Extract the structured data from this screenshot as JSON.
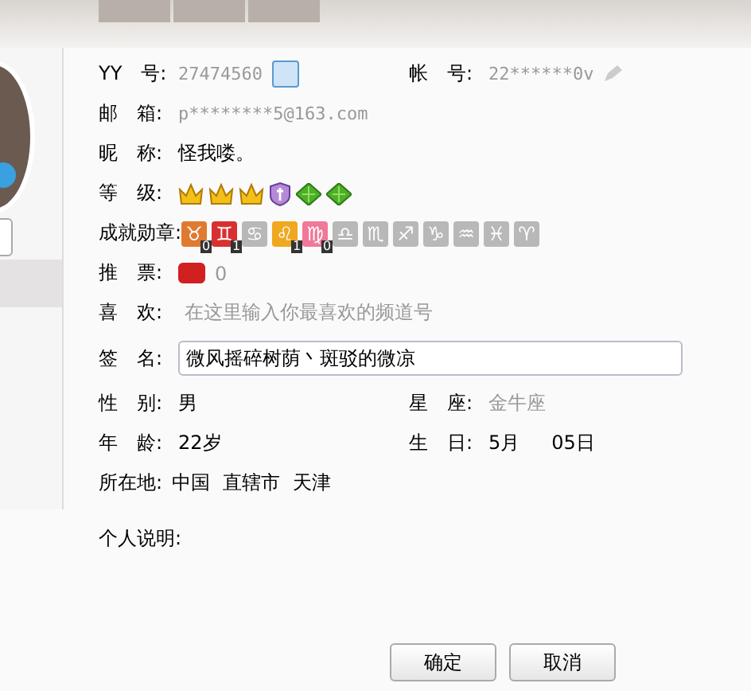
{
  "profile": {
    "fields": [
      {
        "kind": "id",
        "label": "YY　号:",
        "value": "27474560",
        "label2": "帐　号:",
        "value2": "22******0v"
      },
      {
        "kind": "muted",
        "label": "邮　箱:",
        "value": "p********5@163.com"
      },
      {
        "kind": "plain",
        "label": "昵　称:",
        "value": "怪我喽。"
      }
    ],
    "level": {
      "label": "等　级:",
      "icons": [
        {
          "kind": "crown"
        },
        {
          "kind": "crown"
        },
        {
          "kind": "crown"
        },
        {
          "kind": "shield"
        },
        {
          "kind": "leaf"
        },
        {
          "kind": "leaf"
        }
      ]
    },
    "medals": {
      "label": "成就勋章:",
      "items": [
        {
          "symbol": "♉",
          "color": "#e07a30",
          "count": "0"
        },
        {
          "symbol": "♊",
          "color": "#d83030",
          "count": "1"
        },
        {
          "symbol": "♋",
          "color": "#b8b8b8"
        },
        {
          "symbol": "♌",
          "color": "#f0a820",
          "count": "1"
        },
        {
          "symbol": "♍",
          "color": "#f07898",
          "count": "0"
        },
        {
          "symbol": "♎",
          "color": "#b8b8b8"
        },
        {
          "symbol": "♏",
          "color": "#b8b8b8"
        },
        {
          "symbol": "♐",
          "color": "#b8b8b8"
        },
        {
          "symbol": "♑",
          "color": "#b8b8b8"
        },
        {
          "symbol": "♒",
          "color": "#b8b8b8"
        },
        {
          "symbol": "♓",
          "color": "#b8b8b8"
        },
        {
          "symbol": "♈",
          "color": "#b8b8b8"
        }
      ]
    },
    "votes": {
      "label": "推　票:",
      "value": "0"
    },
    "favorite": {
      "label": "喜　欢:",
      "placeholder": "在这里输入你最喜欢的频道号"
    },
    "signature": {
      "label": "签　名:",
      "value": "微风摇碎树荫丶斑驳的微凉"
    },
    "pairs": [
      {
        "label": "性　别:",
        "value": "男",
        "label2": "星　座:",
        "value2": "金牛座"
      },
      {
        "label": "年　龄:",
        "value": "22岁",
        "label2": "生　日:",
        "value2": "5月",
        "value3": "05日"
      }
    ],
    "location": {
      "label": "所在地:",
      "parts": [
        "中国",
        "直辖市",
        "天津"
      ]
    },
    "description": {
      "label": "个人说明:"
    }
  },
  "buttons": [
    "确定",
    "取消"
  ]
}
